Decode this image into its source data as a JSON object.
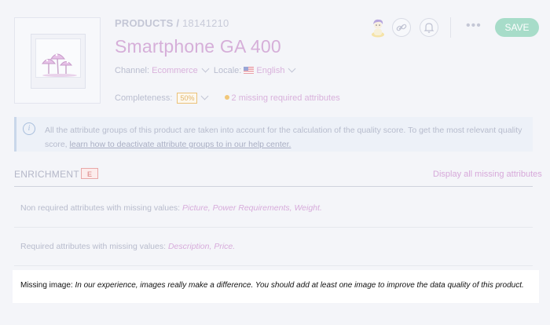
{
  "header": {
    "breadcrumb_section": "PRODUCTS",
    "breadcrumb_separator": " / ",
    "breadcrumb_id": "18141210",
    "title": "Smartphone GA 400",
    "channel_label": "Channel:",
    "channel_value": "Ecommerce",
    "locale_label": "Locale:",
    "locale_value": "English",
    "completeness_label": "Completeness:",
    "completeness_value": "50%",
    "missing_attributes": "2 missing required attributes",
    "save_label": "SAVE",
    "more_label": "•••"
  },
  "info_banner": {
    "text": "All the attribute groups of this product are taken into account for the calculation of the quality score. To get the most relevant quality score, ",
    "link": "learn how to deactivate attribute groups to in our help center."
  },
  "enrichment": {
    "title": "ENRICHMENT",
    "grade": "E",
    "display_all": "Display all missing attributes",
    "non_required_label": "Non required attributes with missing values:",
    "non_required_items": [
      "Picture,",
      "Power Requirements,",
      "Weight."
    ],
    "required_label": "Required attributes with missing values:",
    "required_items": [
      "Description,",
      "Price."
    ],
    "missing_image_label": "Missing image:",
    "missing_image_text": "In our experience, images really make a difference. You should add at least one image to improve the data quality of this product."
  },
  "icons": {
    "info": "info-icon",
    "link": "link-icon",
    "bell": "bell-icon",
    "avatar": "user-avatar",
    "flag": "us-flag-icon"
  },
  "colors": {
    "accent_purple": "#d6afd9",
    "save_green": "#a7dcc9",
    "warning_orange": "#f1c77a",
    "grade_red": "#e29b9b"
  }
}
